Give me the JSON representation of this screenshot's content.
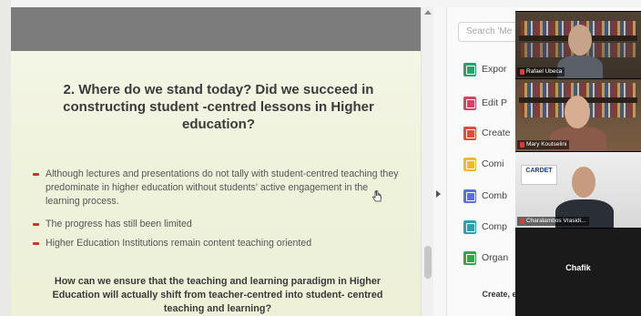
{
  "slide": {
    "title": "2. Where do we stand today?  Did we succeed in constructing student -centred lessons in Higher education?",
    "bullets": [
      "Although lectures and presentations do not tally with student-centred teaching they predominate in higher education without students' active engagement in the learning process.",
      "The progress has still been limited",
      "Higher Education Institutions remain content teaching oriented"
    ],
    "closing": "How can we ensure that the teaching and learning paradigm in Higher Education will actually shift from teacher-centred into student- centred teaching and learning?"
  },
  "tools": {
    "search_placeholder": "Search 'Me",
    "items": [
      {
        "label": "Expor",
        "icon": "export-pdf-icon",
        "color": "#2e9e6b"
      },
      {
        "label": "Edit P",
        "icon": "edit-pdf-icon",
        "color": "#d04563"
      },
      {
        "label": "Create",
        "icon": "create-pdf-icon",
        "color": "#e24a3c"
      },
      {
        "label": "Comi",
        "icon": "comment-icon",
        "color": "#f2b630"
      },
      {
        "label": "Comb",
        "icon": "combine-files-icon",
        "color": "#5b6ee1"
      },
      {
        "label": "Comp",
        "icon": "compress-pdf-icon",
        "color": "#2f9fb0"
      },
      {
        "label": "Organ",
        "icon": "organize-pages-icon",
        "color": "#3aa14a"
      }
    ],
    "promo": "Create, edi... forms & agreements"
  },
  "participants": [
    {
      "name": "Rafael Ubeca"
    },
    {
      "name": "Mary Koutselini"
    },
    {
      "name": "Charalambos Vrasidi..."
    },
    {
      "name": "Chafik"
    }
  ],
  "logo_text": "CARDET"
}
